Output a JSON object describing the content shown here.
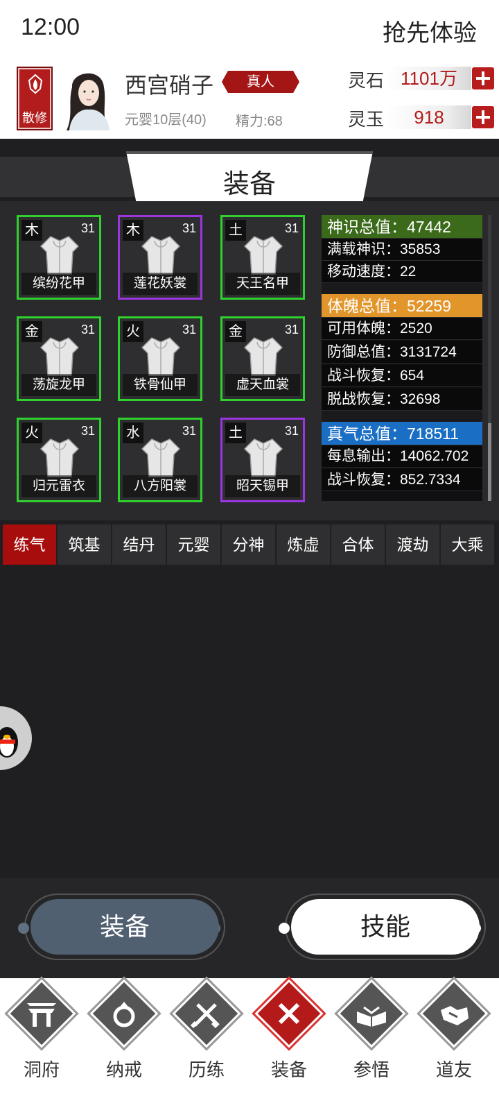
{
  "status_bar": {
    "time": "12:00",
    "right_text": "抢先体验"
  },
  "player": {
    "sect": "散修",
    "name": "西宫硝子",
    "title": "真人",
    "realm": "元婴10层(40)",
    "energy": "精力:68"
  },
  "currencies": [
    {
      "label": "灵石",
      "value": "1101万"
    },
    {
      "label": "灵玉",
      "value": "918"
    }
  ],
  "banner_title": "装备",
  "equipment": [
    {
      "element": "木",
      "level": "31",
      "name": "缤纷花甲",
      "rarity": "green"
    },
    {
      "element": "木",
      "level": "31",
      "name": "莲花妖裳",
      "rarity": "purple"
    },
    {
      "element": "土",
      "level": "31",
      "name": "天王名甲",
      "rarity": "green"
    },
    {
      "element": "金",
      "level": "31",
      "name": "荡旋龙甲",
      "rarity": "green"
    },
    {
      "element": "火",
      "level": "31",
      "name": "铁骨仙甲",
      "rarity": "green"
    },
    {
      "element": "金",
      "level": "31",
      "name": "虚天血裳",
      "rarity": "green"
    },
    {
      "element": "火",
      "level": "31",
      "name": "归元雷衣",
      "rarity": "green"
    },
    {
      "element": "水",
      "level": "31",
      "name": "八方阳裳",
      "rarity": "green"
    },
    {
      "element": "土",
      "level": "31",
      "name": "昭天锡甲",
      "rarity": "purple"
    }
  ],
  "stats": {
    "spirit_total": "神识总值：47442",
    "spirit_carry": "满载神识：35853",
    "move_speed": "移动速度：22",
    "body_total": "体魄总值：52259",
    "body_usable": "可用体魄：2520",
    "defense_total": "防御总值：3131724",
    "battle_recover": "战斗恢复：654",
    "offbattle_recover": "脱战恢复：32698",
    "qi_total": "真气总值：718511",
    "qi_output": "每息输出：14062.702",
    "qi_battle_recover": "战斗恢复：852.7334",
    "colors": {
      "spirit": "#3b6a1a",
      "body": "#e2952a",
      "qi": "#1a6fc4"
    }
  },
  "realm_tabs": [
    "练气",
    "筑基",
    "结丹",
    "元婴",
    "分神",
    "炼虚",
    "合体",
    "渡劫",
    "大乘"
  ],
  "active_tab": "练气",
  "buttons": {
    "equip": "装备",
    "skill": "技能"
  },
  "nav": [
    {
      "label": "洞府",
      "icon": "gate-icon"
    },
    {
      "label": "纳戒",
      "icon": "ring-icon"
    },
    {
      "label": "历练",
      "icon": "crossed-swords-icon"
    },
    {
      "label": "装备",
      "icon": "close-x-icon",
      "active": true
    },
    {
      "label": "参悟",
      "icon": "open-book-icon"
    },
    {
      "label": "道友",
      "icon": "handshake-icon"
    }
  ]
}
